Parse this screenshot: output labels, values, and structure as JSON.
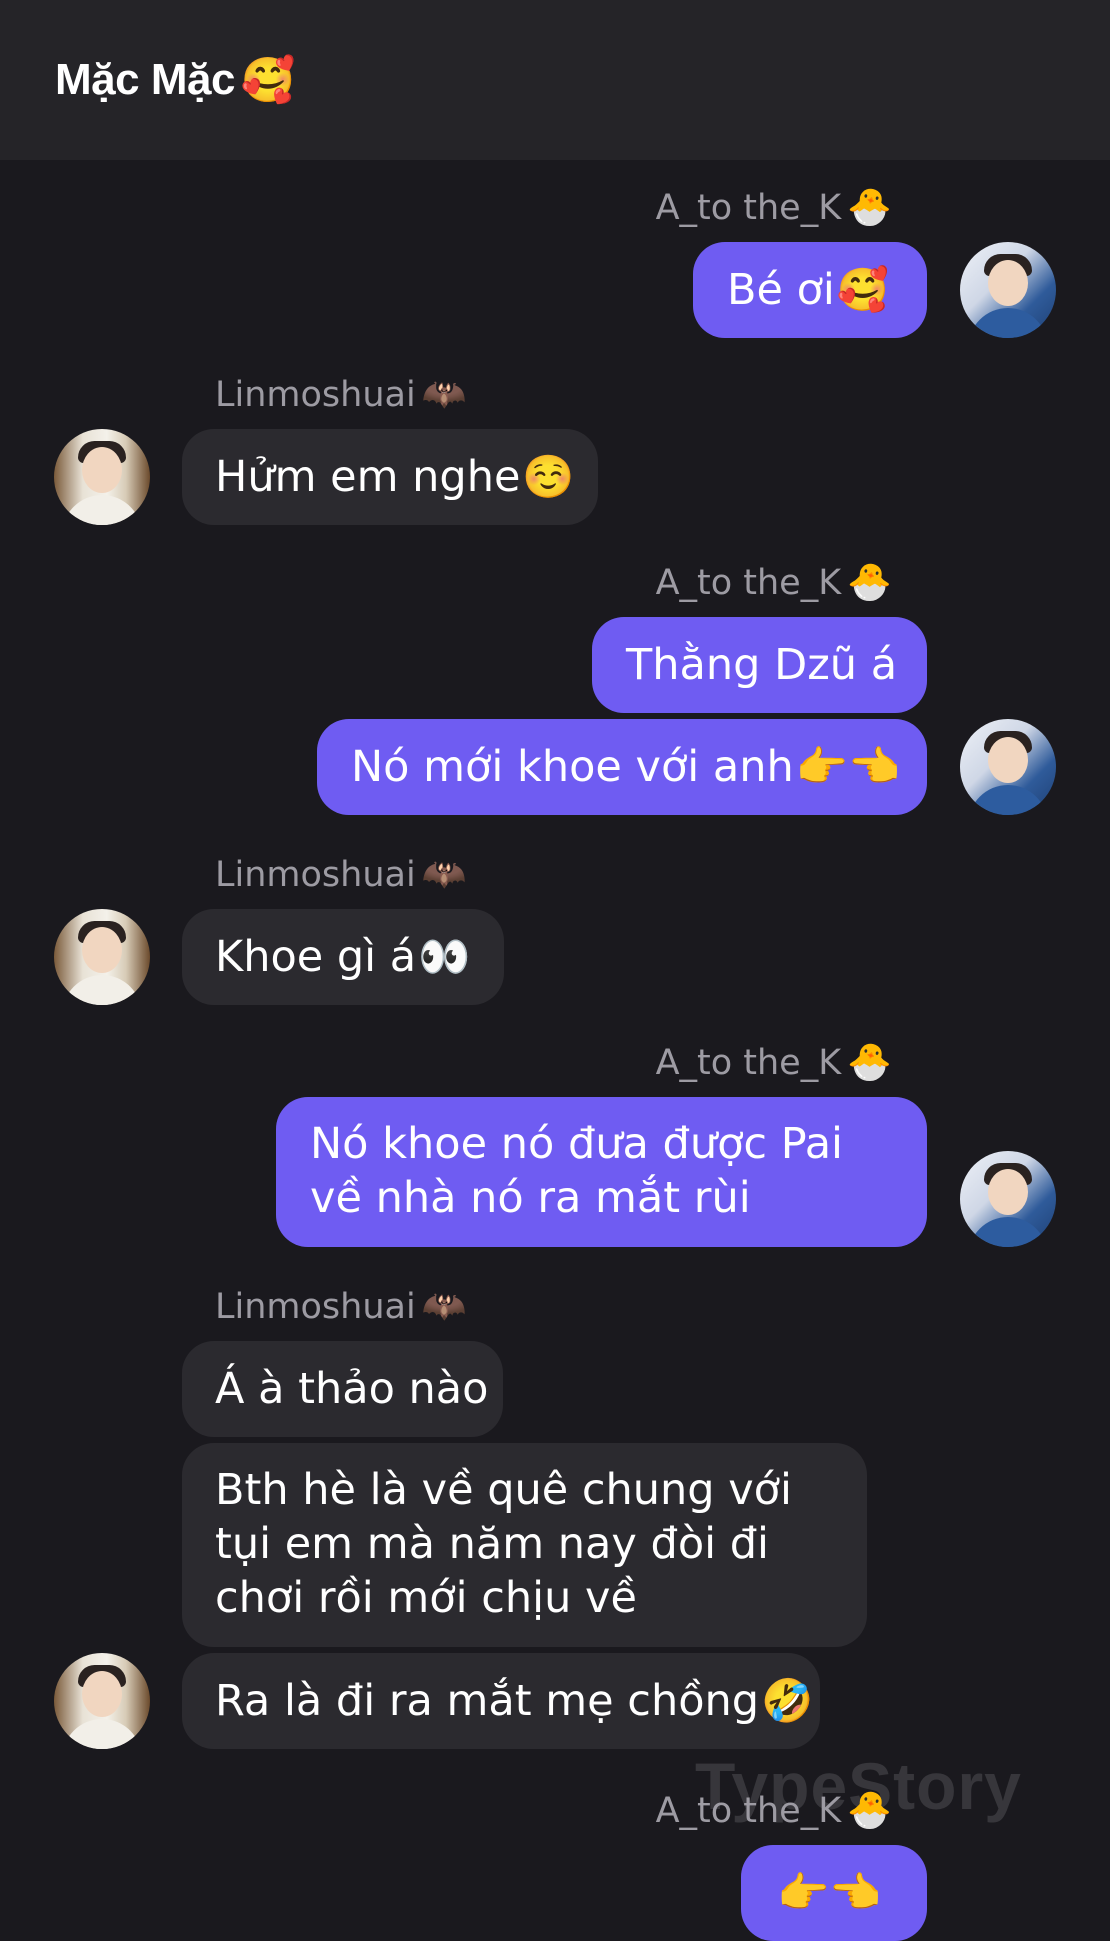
{
  "header": {
    "title": "Mặc Mặc",
    "emoji": "🥰"
  },
  "messages": [
    {
      "sender": "A_to the_K",
      "sender_emoji": "🐣",
      "text": "Bé ơi",
      "emoji": "🥰"
    },
    {
      "sender": "Linmoshuai",
      "sender_emoji": "🦇",
      "text": "Hửm em nghe",
      "emoji": "☺️"
    },
    {
      "sender": "A_to the_K",
      "sender_emoji": "🐣",
      "text": "Thằng Dzũ á"
    },
    {
      "text": "Nó mới khoe với anh",
      "emoji": "👉👈"
    },
    {
      "sender": "Linmoshuai",
      "sender_emoji": "🦇",
      "text": "Khoe gì á",
      "emoji": "👀"
    },
    {
      "sender": "A_to the_K",
      "sender_emoji": "🐣",
      "text": "Nó khoe nó đưa được Pai về nhà nó ra mắt rùi"
    },
    {
      "sender": "Linmoshuai",
      "sender_emoji": "🦇",
      "text": "Á à thảo nào"
    },
    {
      "text": "Bth hè là về quê chung với tụi em mà năm nay đòi đi chơi rồi mới chịu về"
    },
    {
      "text": "Ra là đi ra mắt mẹ chồng",
      "emoji": "🤣"
    },
    {
      "sender": "A_to the_K",
      "sender_emoji": "🐣",
      "emoji": "👉👈"
    }
  ],
  "watermark": "TypeStory",
  "colors": {
    "background": "#1a191e",
    "header": "#252428",
    "outgoing_bubble": "#6f5cf2",
    "incoming_bubble": "#2b2a2f",
    "sender_text": "#9d9ba3"
  }
}
